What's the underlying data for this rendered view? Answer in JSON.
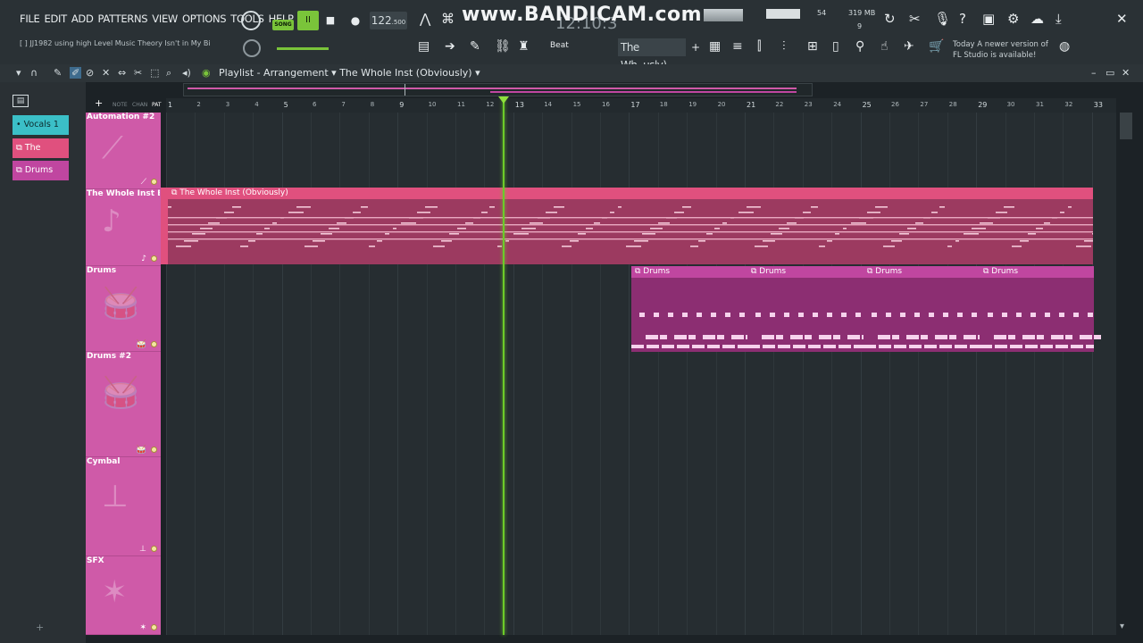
{
  "menu": [
    "FILE",
    "EDIT",
    "ADD",
    "PATTERNS",
    "VIEW",
    "OPTIONS",
    "TOOLS",
    "HELP"
  ],
  "hint_text": "JJ1982 using high Level Music Theory Isn't in My Bi",
  "transport": {
    "song_label": "SONG",
    "pause_glyph": "II",
    "stop_glyph": "■",
    "record_glyph": "●",
    "tempo_int": "122",
    "tempo_frac": ".500",
    "time": "12:10:3"
  },
  "watermark": "www.BANDICAM.com",
  "monitor": {
    "cpu_number": "54",
    "memory": "319 MB",
    "polyphony": "9"
  },
  "toolbar2": {
    "snap": "Beat",
    "pattern_name": "The Wh..usly)",
    "add": "+"
  },
  "news": {
    "line1": "Today  A newer version of",
    "line2": "FL Studio is available!"
  },
  "playlist": {
    "title": "Playlist - Arrangement",
    "arrangement": "The Whole Inst (Obviously)"
  },
  "pattern_picker": [
    {
      "label": "Vocals 1",
      "color": "#3bbfc7"
    },
    {
      "label": "The W..usly",
      "color": "#e0507e"
    },
    {
      "label": "Drums",
      "color": "#c046a0"
    }
  ],
  "tracks": [
    {
      "name": "Automation #2",
      "icon": "automation-icon",
      "glyph": "⟋"
    },
    {
      "name": "The Whole Inst Bru",
      "icon": "note-icon",
      "glyph": "♪"
    },
    {
      "name": "Drums",
      "icon": "drum-icon",
      "glyph": "🥁"
    },
    {
      "name": "Drums #2",
      "icon": "drum-icon",
      "glyph": "🥁"
    },
    {
      "name": "Cymbal",
      "icon": "cymbal-icon",
      "glyph": "⊥"
    },
    {
      "name": "SFX",
      "icon": "sfx-icon",
      "glyph": "✶"
    }
  ],
  "ruler": [
    "1",
    "2",
    "3",
    "4",
    "5",
    "6",
    "7",
    "8",
    "9",
    "10",
    "11",
    "12",
    "13",
    "14",
    "15",
    "16",
    "17",
    "18",
    "19",
    "20",
    "21",
    "22",
    "23",
    "24",
    "25",
    "26",
    "27",
    "28",
    "29",
    "30",
    "31",
    "32",
    "33"
  ],
  "clips": {
    "inst": "The Whole Inst (Obviously)",
    "drums": [
      "Drums",
      "Drums",
      "Drums",
      "Drums"
    ]
  },
  "colors": {
    "accent_green": "#7ac43a",
    "track_pink": "#cf5aa8",
    "inst_clip": "#e0507e",
    "drum_clip": "#c046a0"
  }
}
